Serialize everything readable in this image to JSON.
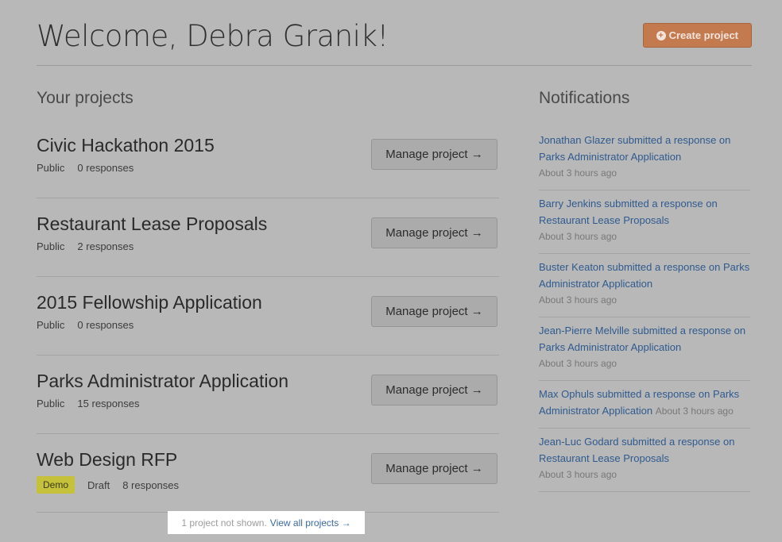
{
  "header": {
    "title": "Welcome, Debra Granik!",
    "create_button": "Create project"
  },
  "projects_section": {
    "title": "Your projects",
    "manage_label": "Manage project →",
    "items": [
      {
        "name": "Civic Hackathon 2015",
        "visibility": "Public",
        "responses": "0 responses"
      },
      {
        "name": "Restaurant Lease Proposals",
        "visibility": "Public",
        "responses": "2 responses"
      },
      {
        "name": "2015 Fellowship Application",
        "visibility": "Public",
        "responses": "0 responses"
      },
      {
        "name": "Parks Administrator Application",
        "visibility": "Public",
        "responses": "15 responses"
      },
      {
        "name": "Web Design RFP",
        "badge": "Demo",
        "visibility": "Draft",
        "responses": "8 responses"
      }
    ],
    "hidden_note": "1 project not shown.",
    "view_all_link": "View all projects →"
  },
  "notifications": {
    "title": "Notifications",
    "items": [
      {
        "message": "Jonathan Glazer submitted a response on Parks Administrator Application",
        "time": "About 3 hours ago"
      },
      {
        "message": "Barry Jenkins submitted a response on Restaurant Lease Proposals",
        "time": "About 3 hours ago"
      },
      {
        "message": "Buster Keaton submitted a response on Parks Administrator Application",
        "time": "About 3 hours ago"
      },
      {
        "message": "Jean-Pierre Melville submitted a response on Parks Administrator Application",
        "time": "About 3 hours ago"
      },
      {
        "message": "Max Ophuls submitted a response on Parks Administrator Application",
        "time": "About 3 hours ago"
      },
      {
        "message": "Jean-Luc Godard submitted a response on Restaurant Lease Proposals",
        "time": "About 3 hours ago"
      }
    ]
  },
  "colors": {
    "background": "#b8b8b8",
    "accent_button": "#c47a4f",
    "link": "#2f5a8f",
    "demo_badge": "#c5c13a"
  }
}
